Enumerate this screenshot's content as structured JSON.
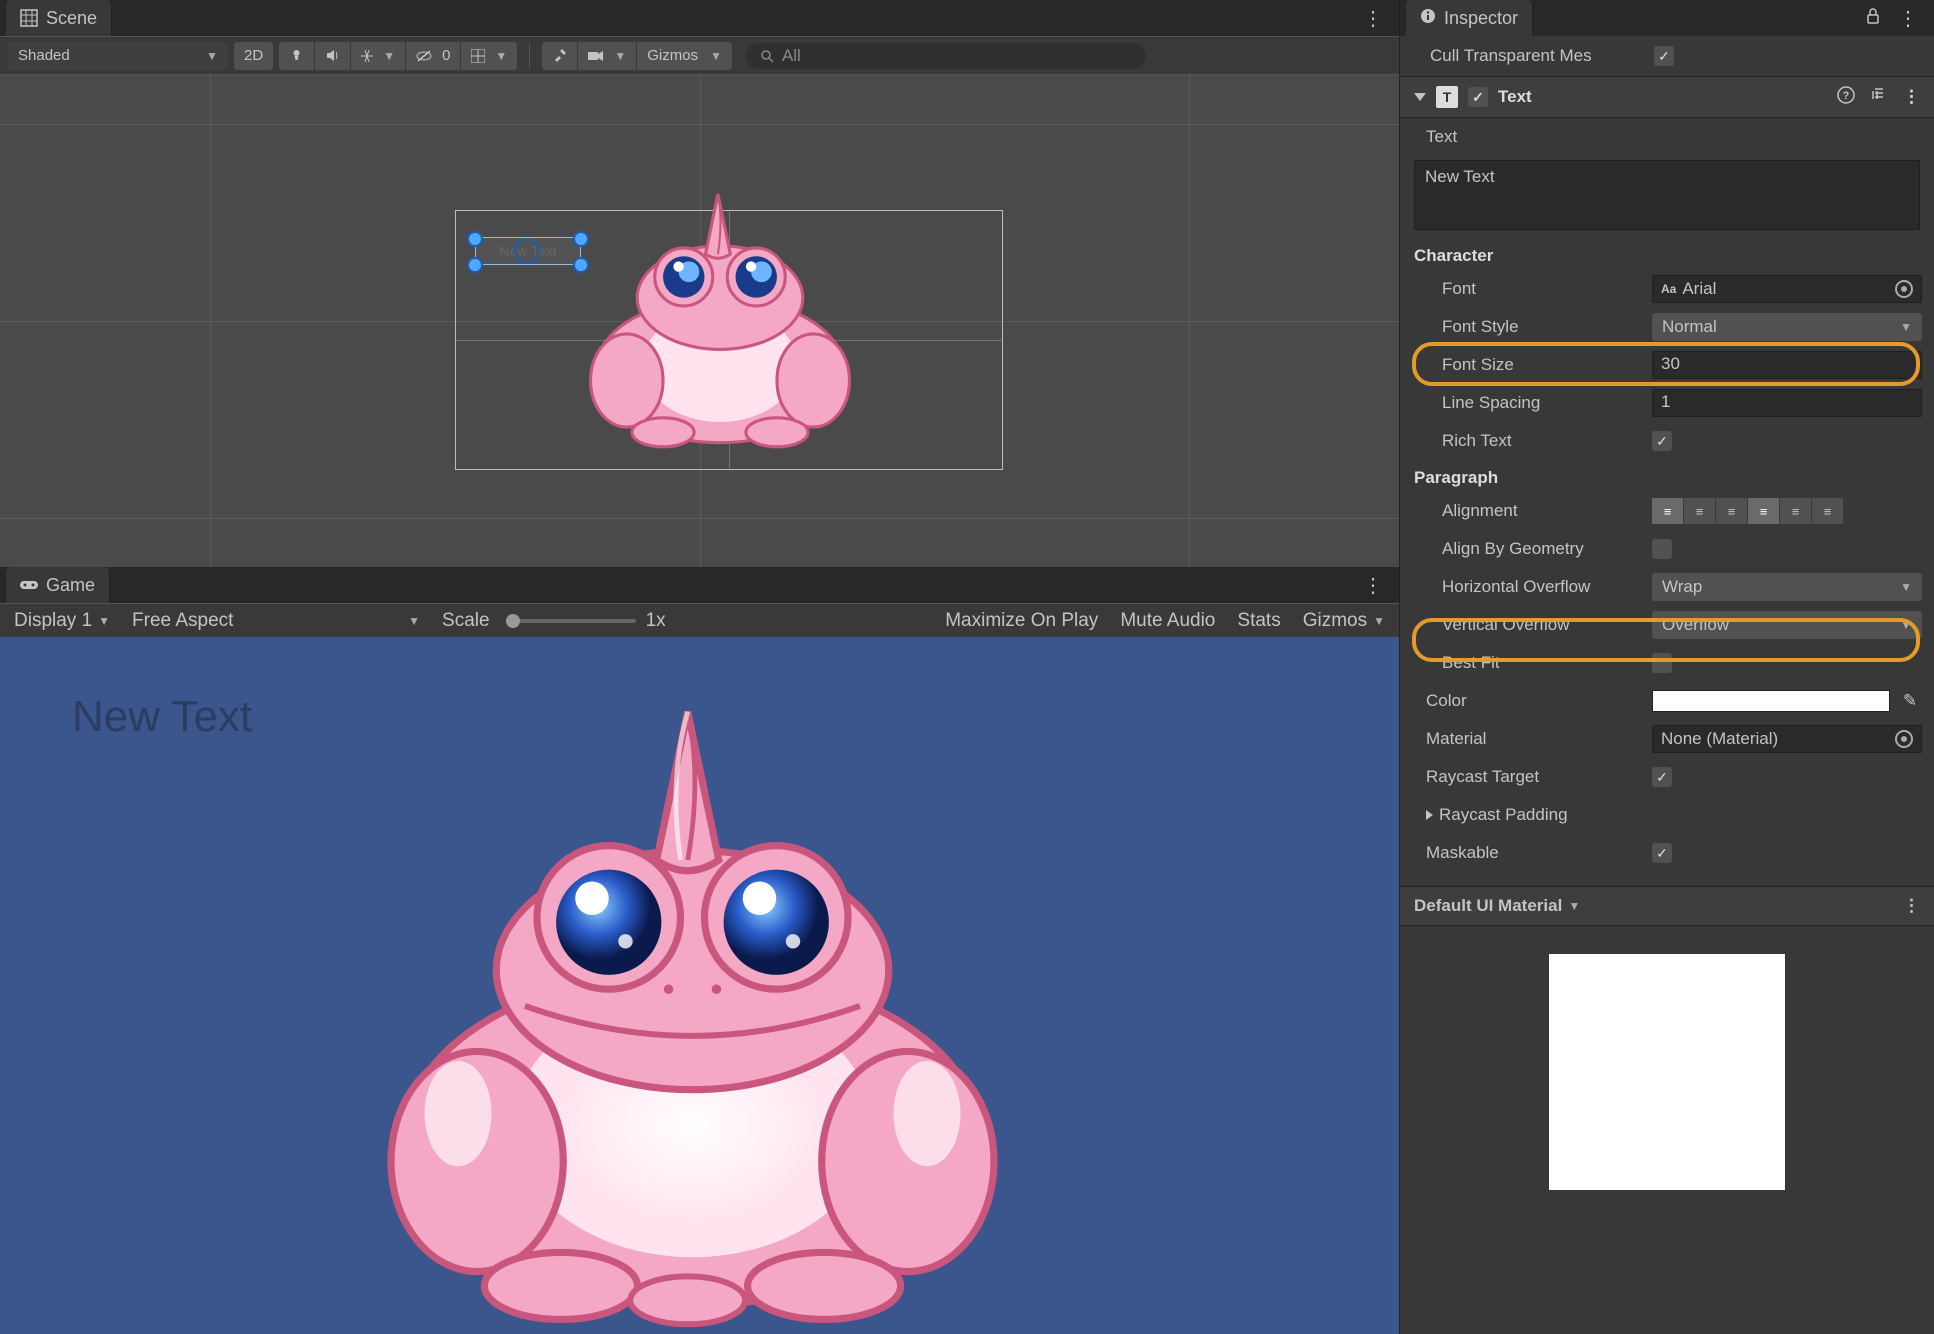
{
  "scene": {
    "tab": "Scene",
    "shading": "Shaded",
    "mode2d": "2D",
    "visibility": "0",
    "gizmos": "Gizmos",
    "search_placeholder": "All"
  },
  "game": {
    "tab": "Game",
    "display": "Display 1",
    "aspect": "Free Aspect",
    "scale_label": "Scale",
    "scale_value": "1x",
    "maximize": "Maximize On Play",
    "mute": "Mute Audio",
    "stats": "Stats",
    "gizmos": "Gizmos",
    "new_text": "New Text"
  },
  "inspector": {
    "tab": "Inspector",
    "cull_label": "Cull Transparent Mes",
    "component": "Text",
    "text_label": "Text",
    "text_value": "New Text",
    "character": "Character",
    "font_label": "Font",
    "font_value": "Arial",
    "font_prefix": "Aa",
    "fontstyle_label": "Font Style",
    "fontstyle_value": "Normal",
    "fontsize_label": "Font Size",
    "fontsize_value": "30",
    "linespacing_label": "Line Spacing",
    "linespacing_value": "1",
    "richtext_label": "Rich Text",
    "paragraph": "Paragraph",
    "alignment_label": "Alignment",
    "aligngeom_label": "Align By Geometry",
    "hoverflow_label": "Horizontal Overflow",
    "hoverflow_value": "Wrap",
    "voverflow_label": "Vertical Overflow",
    "voverflow_value": "Overflow",
    "bestfit_label": "Best Fit",
    "color_label": "Color",
    "material_label": "Material",
    "material_value": "None (Material)",
    "raycast_label": "Raycast Target",
    "raypad_label": "Raycast Padding",
    "maskable_label": "Maskable",
    "default_material": "Default UI Material"
  }
}
